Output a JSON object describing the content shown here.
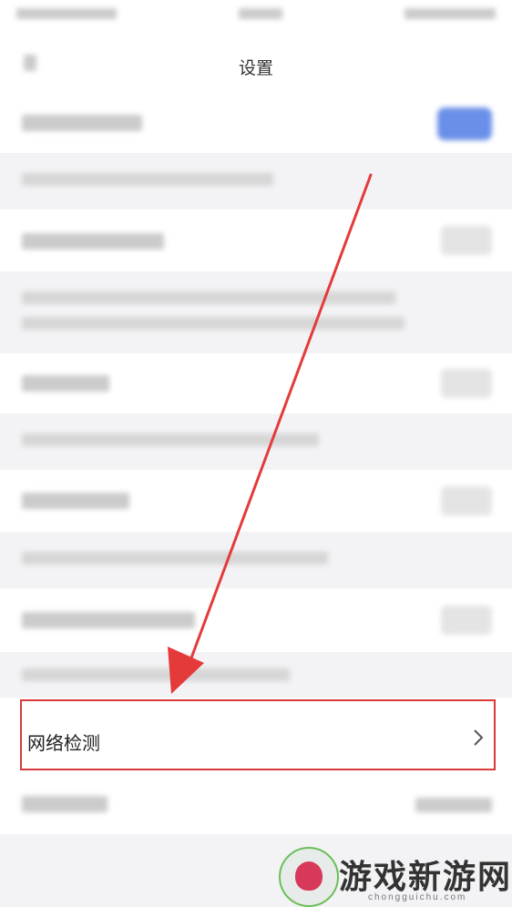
{
  "header": {
    "title": "设置"
  },
  "settings": {
    "network_check_label": "网络检测"
  },
  "watermark": {
    "name": "游戏新游网",
    "url": "chongguichu.com"
  },
  "colors": {
    "highlight_border": "#d93a3a",
    "arrow": "#e53a3a",
    "toggle_on": "#6a8fe8"
  }
}
